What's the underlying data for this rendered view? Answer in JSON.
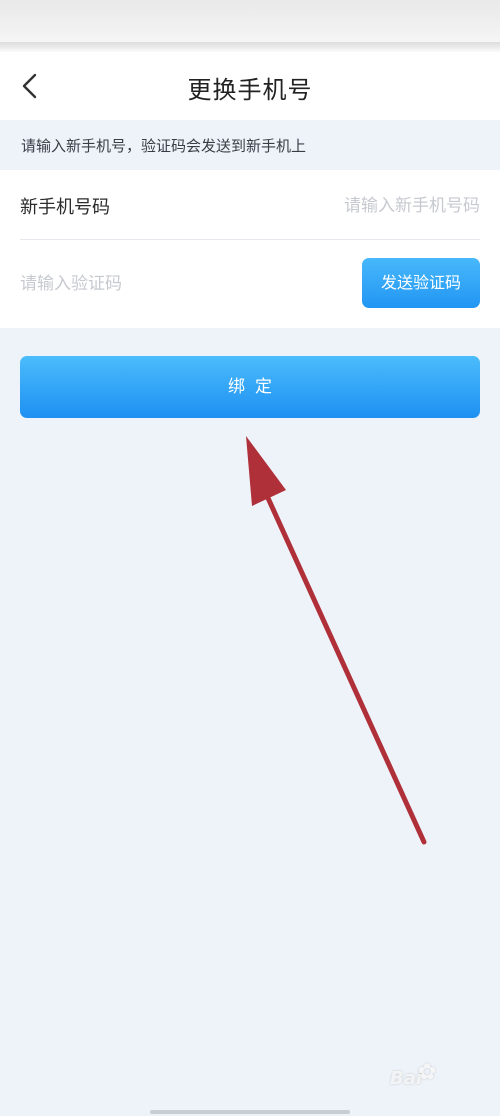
{
  "header": {
    "back_icon": "chevron-left-icon",
    "title": "更换手机号"
  },
  "notice": {
    "text": "请输入新手机号，验证码会发送到新手机上"
  },
  "form": {
    "phone": {
      "label": "新手机号码",
      "value": "",
      "placeholder": "请输入新手机号码"
    },
    "code": {
      "value": "",
      "placeholder": "请输入验证码",
      "send_button_label": "发送验证码"
    }
  },
  "bind_button": {
    "label": "绑定"
  },
  "annotation": {
    "icon": "arrow-annotation",
    "color": "#b0303a"
  },
  "watermark": {
    "text": "Bai",
    "icon": "paw-icon"
  },
  "colors": {
    "accent": "#2196f3",
    "background": "#eef3fa"
  }
}
